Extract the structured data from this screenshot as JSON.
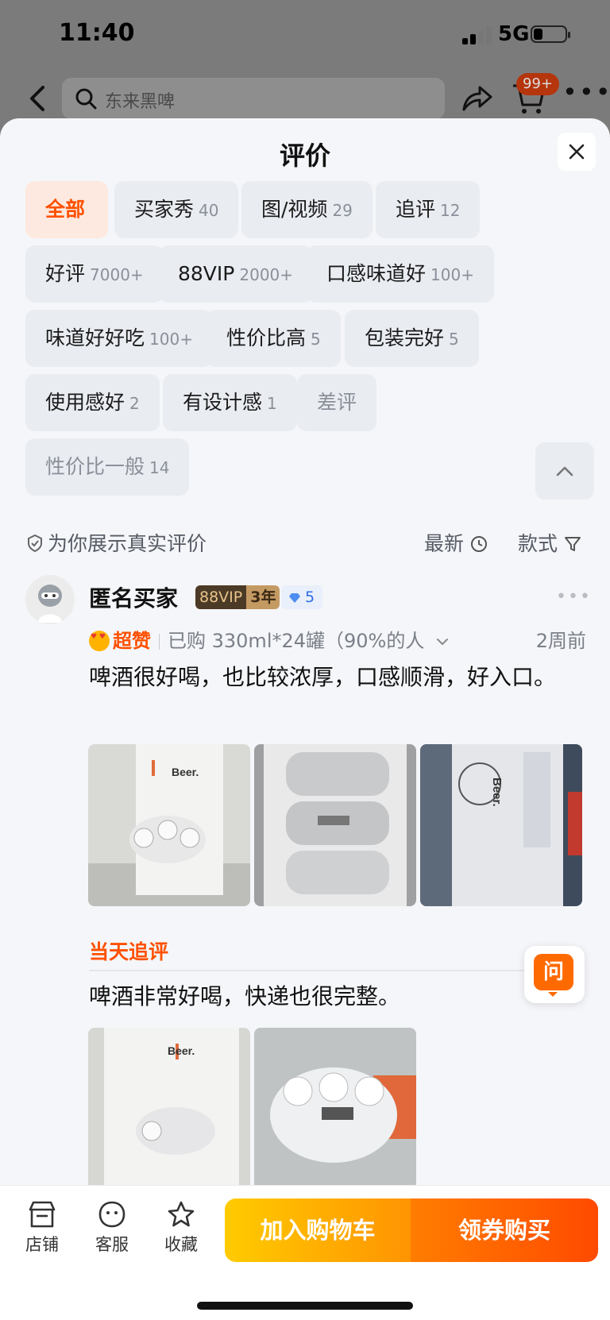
{
  "status": {
    "time": "11:40",
    "network": "5G"
  },
  "header": {
    "search_placeholder": "东来黑啤",
    "cart_badge": "99+"
  },
  "sheet": {
    "title": "评价",
    "chips": [
      {
        "label": "全部",
        "count": "",
        "state": "active"
      },
      {
        "label": "买家秀",
        "count": "40"
      },
      {
        "label": "图/视频",
        "count": "29"
      },
      {
        "label": "追评",
        "count": "12"
      },
      {
        "label": "好评",
        "count": "7000+"
      },
      {
        "label": "88VIP",
        "count": "2000+"
      },
      {
        "label": "口感味道好",
        "count": "100+"
      },
      {
        "label": "味道好好吃",
        "count": "100+"
      },
      {
        "label": "性价比高",
        "count": "5"
      },
      {
        "label": "包装完好",
        "count": "5"
      },
      {
        "label": "使用感好",
        "count": "2"
      },
      {
        "label": "有设计感",
        "count": "1"
      },
      {
        "label": "差评",
        "count": "",
        "state": "muted"
      },
      {
        "label": "性价比一般",
        "count": "14",
        "state": "muted"
      }
    ],
    "filter": {
      "verified": "为你展示真实评价",
      "sort_newest": "最新",
      "sort_style": "款式"
    }
  },
  "review": {
    "username": "匿名买家",
    "vip_left": "88VIP",
    "vip_right": "3年",
    "level": "5",
    "super_label": "超赞",
    "purchase": "已购 330ml*24罐（90%的人",
    "time": "2周前",
    "text": "啤酒很好喝，也比较浓厚，口感顺滑，好入口。",
    "followup_title": "当天追评",
    "followup_text": "啤酒非常好喝，快递也很完整。"
  },
  "ask_button": "问",
  "bottom_bar": {
    "shop": "店铺",
    "service": "客服",
    "favorite": "收藏",
    "add_to_cart": "加入购物车",
    "buy_with_coupon": "领券购买"
  },
  "colors": {
    "accent": "#ff5000",
    "chip_bg": "#e9ecf1",
    "add_cart_gradient": "#ffcb00",
    "buy_gradient": "#ff4a00"
  }
}
